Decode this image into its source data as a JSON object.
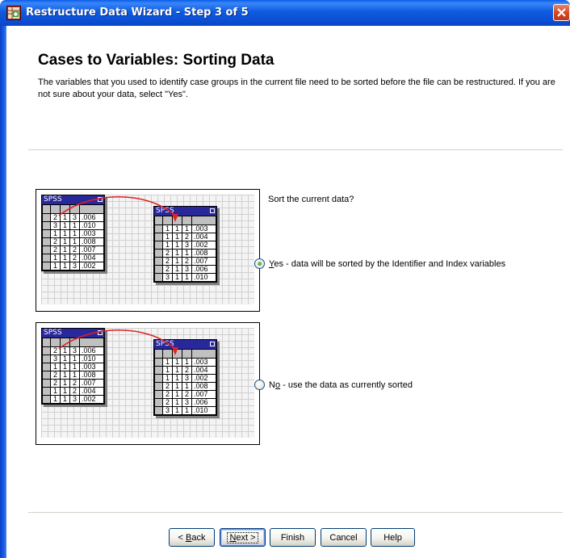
{
  "window": {
    "title": "Restructure Data Wizard - Step 3 of 5",
    "icon": "spss-wizard-icon"
  },
  "page": {
    "heading": "Cases to Variables: Sorting Data",
    "description": "The variables that you used to identify case groups in the current file need to be sorted before the file can be restructured.  If you are not sure about your data, select \"Yes\"."
  },
  "illustration": {
    "sheet_label": "SPSS",
    "unsorted_rows": [
      [
        "2",
        "1",
        "3",
        ".006"
      ],
      [
        "3",
        "1",
        "1",
        ".010"
      ],
      [
        "1",
        "1",
        "1",
        ".003"
      ],
      [
        "2",
        "1",
        "1",
        ".008"
      ],
      [
        "2",
        "1",
        "2",
        ".007"
      ],
      [
        "1",
        "1",
        "2",
        ".004"
      ],
      [
        "1",
        "1",
        "3",
        ".002"
      ]
    ],
    "sorted_rows": [
      [
        "1",
        "1",
        "1",
        ".003"
      ],
      [
        "1",
        "1",
        "2",
        ".004"
      ],
      [
        "1",
        "1",
        "3",
        ".002"
      ],
      [
        "2",
        "1",
        "1",
        ".008"
      ],
      [
        "2",
        "1",
        "2",
        ".007"
      ],
      [
        "2",
        "1",
        "3",
        ".006"
      ],
      [
        "3",
        "1",
        "1",
        ".010"
      ]
    ]
  },
  "sort_group": {
    "prompt": "Sort the current data?",
    "options": [
      {
        "mnemonic": "Y",
        "label_rest": "es - data will be sorted by the Identifier and Index variables",
        "checked": true
      },
      {
        "label_prefix": "N",
        "mnemonic": "o",
        "label_rest": " - use the data as currently sorted",
        "checked": false
      }
    ]
  },
  "buttons": {
    "back": {
      "prefix": "< ",
      "mnemonic": "B",
      "rest": "ack"
    },
    "next": {
      "mnemonic": "N",
      "rest": "ext >"
    },
    "finish": "Finish",
    "cancel": "Cancel",
    "help": "Help"
  },
  "colors": {
    "titlebar": "#0b4fd4",
    "sheet_header": "#28289a",
    "arrow": "#e02020",
    "radio_checked": "#218a21"
  }
}
